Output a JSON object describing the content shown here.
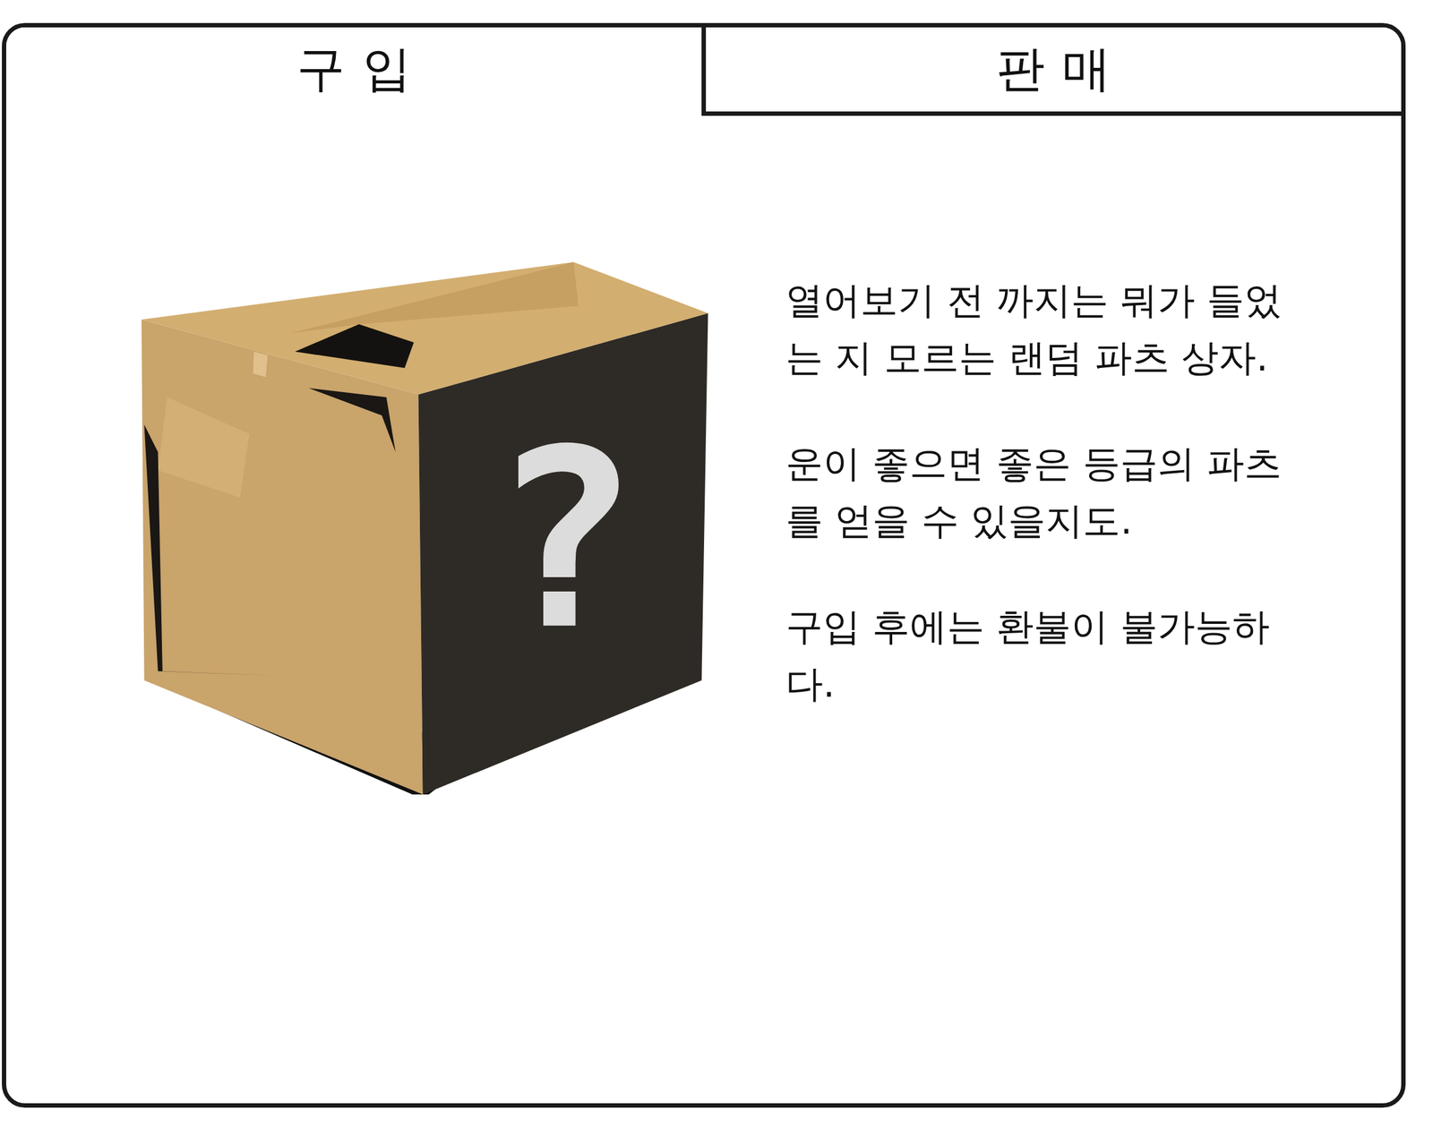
{
  "tabs": [
    {
      "label": "구입",
      "selected": true
    },
    {
      "label": "판매",
      "selected": false
    }
  ],
  "item": {
    "mark": "?",
    "description": [
      "열어보기 전 까지는 뭐가 들었는 지 모르는 랜덤 파츠 상자.",
      "운이 좋으면 좋은 등급의 파츠를 얻을 수 있을지도.",
      "구입 후에는 환불이 불가능하다."
    ]
  }
}
